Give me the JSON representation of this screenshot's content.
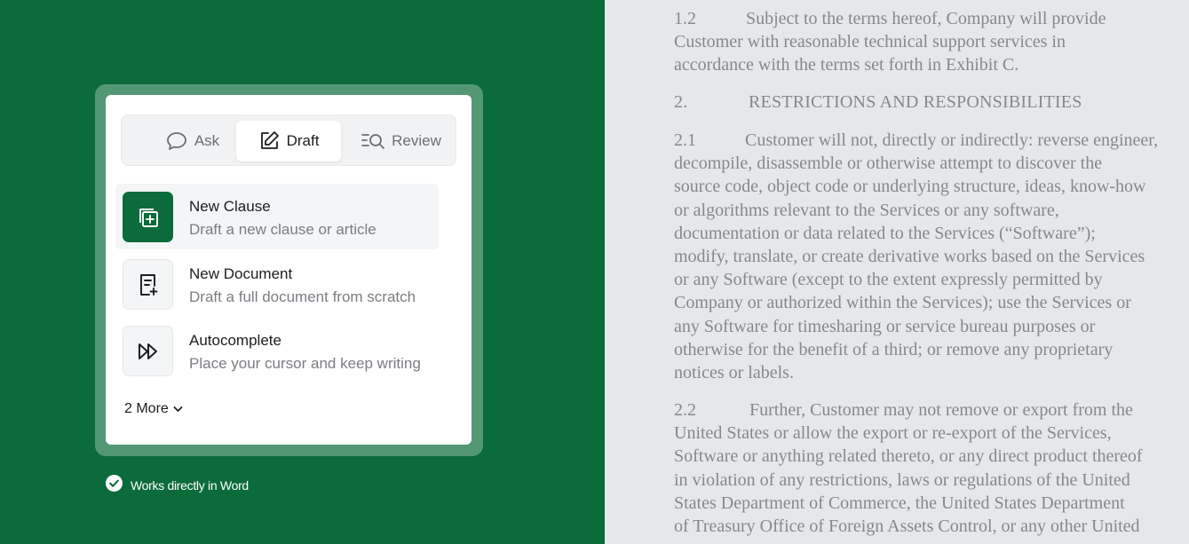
{
  "panel": {
    "tabs": [
      {
        "label": "Ask",
        "icon": "chat-bubble-icon"
      },
      {
        "label": "Draft",
        "icon": "edit-icon",
        "selected": true
      },
      {
        "label": "Review",
        "icon": "search-list-icon"
      }
    ],
    "items": [
      {
        "title": "New Clause",
        "description": "Draft a new clause or article",
        "icon": "add-clause-icon",
        "active": true
      },
      {
        "title": "New Document",
        "description": "Draft a full document from scratch",
        "icon": "new-document-icon"
      },
      {
        "title": "Autocomplete",
        "description": "Place your cursor and keep writing",
        "icon": "fast-forward-icon"
      }
    ],
    "more_label": "2 More"
  },
  "badge": {
    "text": "Works directly in Word",
    "icon": "check-circle-icon"
  },
  "document": {
    "p1": {
      "number": "1.2",
      "lines": [
        "Subject to the terms hereof, Company will provide",
        "Customer with reasonable technical support services in",
        "accordance with the terms set forth in Exhibit C."
      ]
    },
    "h2": {
      "number": "2.",
      "text": "RESTRICTIONS AND RESPONSIBILITIES"
    },
    "p21": {
      "number": "2.1",
      "lines": [
        "Customer will not, directly or indirectly: reverse engineer,",
        "decompile, disassemble or otherwise attempt to discover the",
        "source code, object code or underlying structure, ideas, know-how",
        "or algorithms relevant to the Services or any software,",
        "documentation or data related to the Services (“Software”);",
        "modify, translate, or create derivative works based on the Services",
        "or any Software (except to the extent expressly permitted by",
        "Company or authorized within the Services); use the Services or",
        "any Software for timesharing or service bureau purposes or",
        "otherwise for the benefit of a third; or remove any proprietary",
        "notices or labels."
      ]
    },
    "p22": {
      "number": "2.2",
      "lines": [
        "Further, Customer may not remove or export from the",
        "United States or allow the export or re-export of the Services,",
        "Software or anything related thereto, or any direct product thereof",
        "in violation of any restrictions, laws or regulations of the United",
        "States Department of Commerce, the United States Department",
        "of Treasury Office of Foreign Assets Control, or any other United"
      ]
    }
  },
  "colors": {
    "brand_green": "#0b6b3a",
    "document_bg": "#e5e7ea",
    "document_text": "#86888c"
  }
}
